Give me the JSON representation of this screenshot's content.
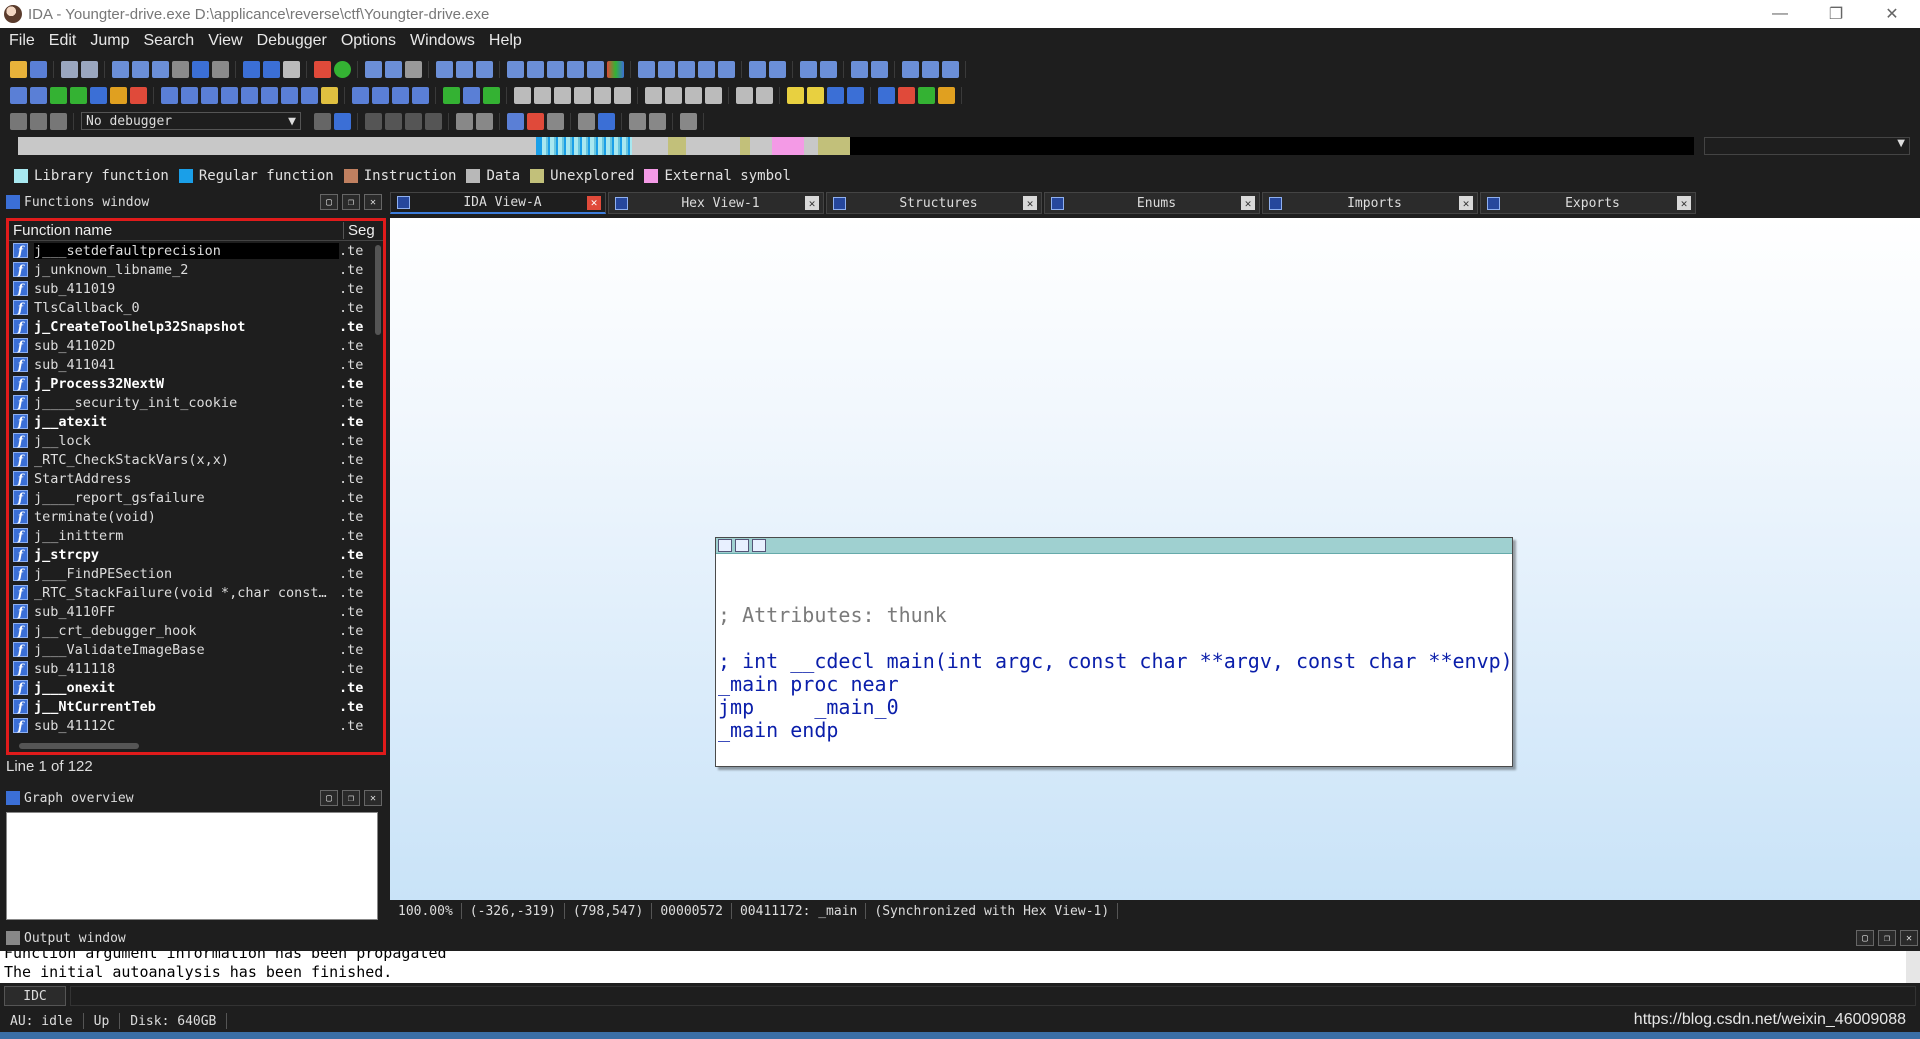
{
  "window": {
    "title": "IDA - Youngter-drive.exe D:\\applicance\\reverse\\ctf\\Youngter-drive.exe",
    "minimize": "—",
    "restore": "❐",
    "close": "✕"
  },
  "menu": [
    "File",
    "Edit",
    "Jump",
    "Search",
    "View",
    "Debugger",
    "Options",
    "Windows",
    "Help"
  ],
  "toolbar": {
    "debugger_select": "No debugger"
  },
  "legend": [
    {
      "label": "Library function",
      "color": "#a8e8f0"
    },
    {
      "label": "Regular function",
      "color": "#1a9fe8"
    },
    {
      "label": "Instruction",
      "color": "#c08060"
    },
    {
      "label": "Data",
      "color": "#b8b8b8"
    },
    {
      "label": "Unexplored",
      "color": "#c2c07a"
    },
    {
      "label": "External symbol",
      "color": "#f49ae6"
    }
  ],
  "functions_window": {
    "title": "Functions window",
    "col_name": "Function name",
    "col_segment": "Seg",
    "line_info": "Line 1 of 122",
    "rows": [
      {
        "name": "j___setdefaultprecision",
        "seg": ".te",
        "bold": false
      },
      {
        "name": "j_unknown_libname_2",
        "seg": ".te",
        "bold": false
      },
      {
        "name": "sub_411019",
        "seg": ".te",
        "bold": false
      },
      {
        "name": "TlsCallback_0",
        "seg": ".te",
        "bold": false
      },
      {
        "name": "j_CreateToolhelp32Snapshot",
        "seg": ".te",
        "bold": true
      },
      {
        "name": "sub_41102D",
        "seg": ".te",
        "bold": false
      },
      {
        "name": "sub_411041",
        "seg": ".te",
        "bold": false
      },
      {
        "name": "j_Process32NextW",
        "seg": ".te",
        "bold": true
      },
      {
        "name": "j____security_init_cookie",
        "seg": ".te",
        "bold": false
      },
      {
        "name": "j__atexit",
        "seg": ".te",
        "bold": true
      },
      {
        "name": "j__lock",
        "seg": ".te",
        "bold": false
      },
      {
        "name": "_RTC_CheckStackVars(x,x)",
        "seg": ".te",
        "bold": false
      },
      {
        "name": "StartAddress",
        "seg": ".te",
        "bold": false
      },
      {
        "name": "j____report_gsfailure",
        "seg": ".te",
        "bold": false
      },
      {
        "name": "terminate(void)",
        "seg": ".te",
        "bold": false
      },
      {
        "name": "j__initterm",
        "seg": ".te",
        "bold": false
      },
      {
        "name": "j_strcpy",
        "seg": ".te",
        "bold": true
      },
      {
        "name": "j___FindPESection",
        "seg": ".te",
        "bold": false
      },
      {
        "name": "_RTC_StackFailure(void *,char const…",
        "seg": ".te",
        "bold": false
      },
      {
        "name": "sub_4110FF",
        "seg": ".te",
        "bold": false
      },
      {
        "name": "j__crt_debugger_hook",
        "seg": ".te",
        "bold": false
      },
      {
        "name": "j___ValidateImageBase",
        "seg": ".te",
        "bold": false
      },
      {
        "name": "sub_411118",
        "seg": ".te",
        "bold": false
      },
      {
        "name": "j___onexit",
        "seg": ".te",
        "bold": true
      },
      {
        "name": "j__NtCurrentTeb",
        "seg": ".te",
        "bold": true
      },
      {
        "name": "sub_41112C",
        "seg": ".te",
        "bold": false
      }
    ]
  },
  "graph_overview": {
    "title": "Graph overview"
  },
  "tabs": [
    {
      "label": "IDA View-A",
      "active": true
    },
    {
      "label": "Hex View-1",
      "active": false
    },
    {
      "label": "Structures",
      "active": false
    },
    {
      "label": "Enums",
      "active": false
    },
    {
      "label": "Imports",
      "active": false
    },
    {
      "label": "Exports",
      "active": false
    }
  ],
  "code_node": {
    "lines": [
      {
        "text": "; Attributes: thunk",
        "kind": "comment"
      },
      {
        "text": "",
        "kind": "blank"
      },
      {
        "text": "; int __cdecl main(int argc, const char **argv, const char **envp)",
        "kind": "asm"
      },
      {
        "text": "_main proc near",
        "kind": "asm"
      },
      {
        "text": "jmp     _main_0",
        "kind": "asm"
      },
      {
        "text": "_main endp",
        "kind": "asm"
      }
    ]
  },
  "view_status": [
    "100.00%",
    "(-326,-319)",
    "(798,547)",
    "00000572",
    "00411172: _main",
    "(Synchronized with Hex View-1)"
  ],
  "output_window": {
    "title": "Output window",
    "partial_line": "Function argument information has been propagated",
    "last_line": "The initial autoanalysis has been finished."
  },
  "idc_button": "IDC",
  "bottom_status": {
    "au": "AU:  idle",
    "direction": "Up",
    "disk": "Disk: 640GB"
  },
  "watermark": "https://blog.csdn.net/weixin_46009088"
}
